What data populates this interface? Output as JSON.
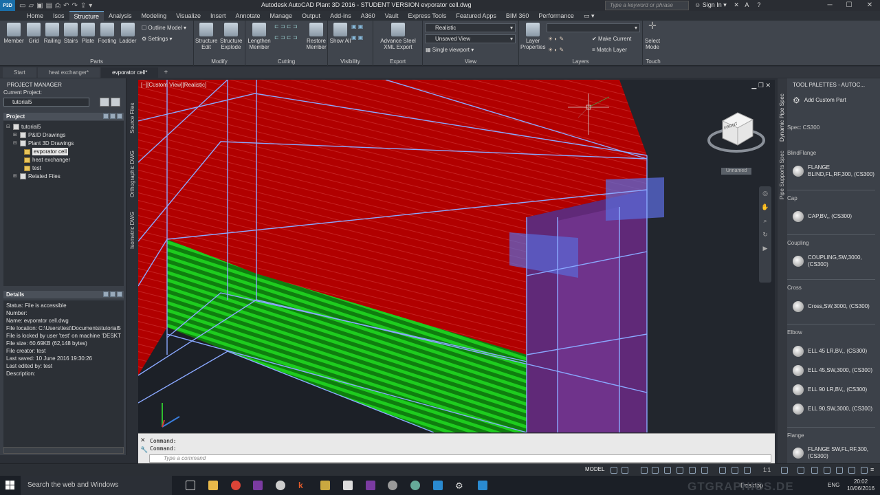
{
  "titlebar": {
    "logo": "P3D",
    "title": "Autodesk AutoCAD Plant 3D 2016 - STUDENT VERSION    evporator cell.dwg",
    "search_placeholder": "Type a keyword or phrase",
    "signin": "Sign In"
  },
  "ribbon_tabs": [
    "Home",
    "Isos",
    "Structure",
    "Analysis",
    "Modeling",
    "Visualize",
    "Insert",
    "Annotate",
    "Manage",
    "Output",
    "Add-ins",
    "A360",
    "Vault",
    "Express Tools",
    "Featured Apps",
    "BIM 360",
    "Performance"
  ],
  "ribbon": {
    "parts": {
      "title": "Parts",
      "buttons": [
        "Member",
        "Grid",
        "Railing",
        "Stairs",
        "Plate",
        "Footing",
        "Ladder"
      ],
      "outline_model": "Outline Model",
      "settings": "Settings"
    },
    "modify": {
      "title": "Modify",
      "buttons": [
        "Structure Edit",
        "Structure Explode"
      ]
    },
    "cutting": {
      "title": "Cutting",
      "buttons": [
        "Lengthen Member"
      ]
    },
    "restore": {
      "buttons": [
        "Restore Member"
      ]
    },
    "visibility": {
      "title": "Visibility",
      "buttons": [
        "Show All"
      ]
    },
    "export": {
      "title": "Export",
      "buttons": [
        "Advance Steel XML Export"
      ]
    },
    "view": {
      "title": "View",
      "visual_style": "Realistic",
      "named_view": "Unsaved View",
      "viewport": "Single viewport"
    },
    "layers": {
      "title": "Layers",
      "layer_props": "Layer Properties",
      "make_current": "Make Current",
      "match_layer": "Match Layer"
    },
    "touch": {
      "title": "Touch",
      "select_mode": "Select Mode"
    }
  },
  "doc_tabs": [
    "Start",
    "heat exchanger*",
    "evporator cell*"
  ],
  "project_manager": {
    "title": "PROJECT MANAGER",
    "current_project_label": "Current Project:",
    "current_project": "tutorial5",
    "project_header": "Project",
    "tree": [
      "tutorial5",
      "P&ID Drawings",
      "Plant 3D Drawings",
      "evporator cell",
      "heat exchanger",
      "test",
      "Related Files"
    ],
    "details_header": "Details",
    "details": [
      "Status: File is accessible",
      "Number:",
      "Name: evporator cell.dwg",
      "File location: C:\\Users\\test\\Documents\\tutorial5",
      "File is locked by user 'test' on machine 'DESKT",
      "File size: 60.69KB (62,148 bytes)",
      "File creator: test",
      "Last saved: 10 June 2016 19:30:26",
      "Last edited by: test",
      "Description:"
    ]
  },
  "side_tabs": [
    "Source Files",
    "Orthographic DWG",
    "Isometric DWG"
  ],
  "viewport": {
    "label": "[−][Custom View][Realistic]",
    "viewcube_label": "Unnamed",
    "cube_face": "FRONT"
  },
  "command": {
    "history": [
      "Command:",
      "Command:"
    ],
    "placeholder": "Type a command"
  },
  "tool_palettes": {
    "title": "TOOL PALETTES - AUTOC...",
    "vertical_tabs": [
      "Dynamic Pipe Spec",
      "Pipe Supports Spec"
    ],
    "add_custom": "Add Custom Part",
    "spec": "Spec: CS300",
    "groups": [
      {
        "category": "BlindFlange",
        "items": [
          "FLANGE BLIND,FL,RF,300, (CS300)"
        ]
      },
      {
        "category": "Cap",
        "items": [
          "CAP,BV,, (CS300)"
        ]
      },
      {
        "category": "Coupling",
        "items": [
          "COUPLING,SW,3000, (CS300)"
        ]
      },
      {
        "category": "Cross",
        "items": [
          "Cross,SW,3000, (CS300)"
        ]
      },
      {
        "category": "Elbow",
        "items": [
          "ELL 45 LR,BV,, (CS300)",
          "ELL 45,SW,3000, (CS300)",
          "ELL 90 LR,BV,, (CS300)",
          "ELL 90,SW,3000, (CS300)"
        ]
      },
      {
        "category": "Flange",
        "items": [
          "FLANGE SW,FL,RF,300, (CS300)"
        ]
      }
    ]
  },
  "statusbar": {
    "model": "MODEL",
    "scale": "1:1"
  },
  "taskbar": {
    "search": "Search the web and Windows",
    "desktop": "Desktop",
    "lang": "ENG",
    "time": "20:02",
    "date": "10/06/2016"
  },
  "watermark": "GTGRAPHICS.DE"
}
